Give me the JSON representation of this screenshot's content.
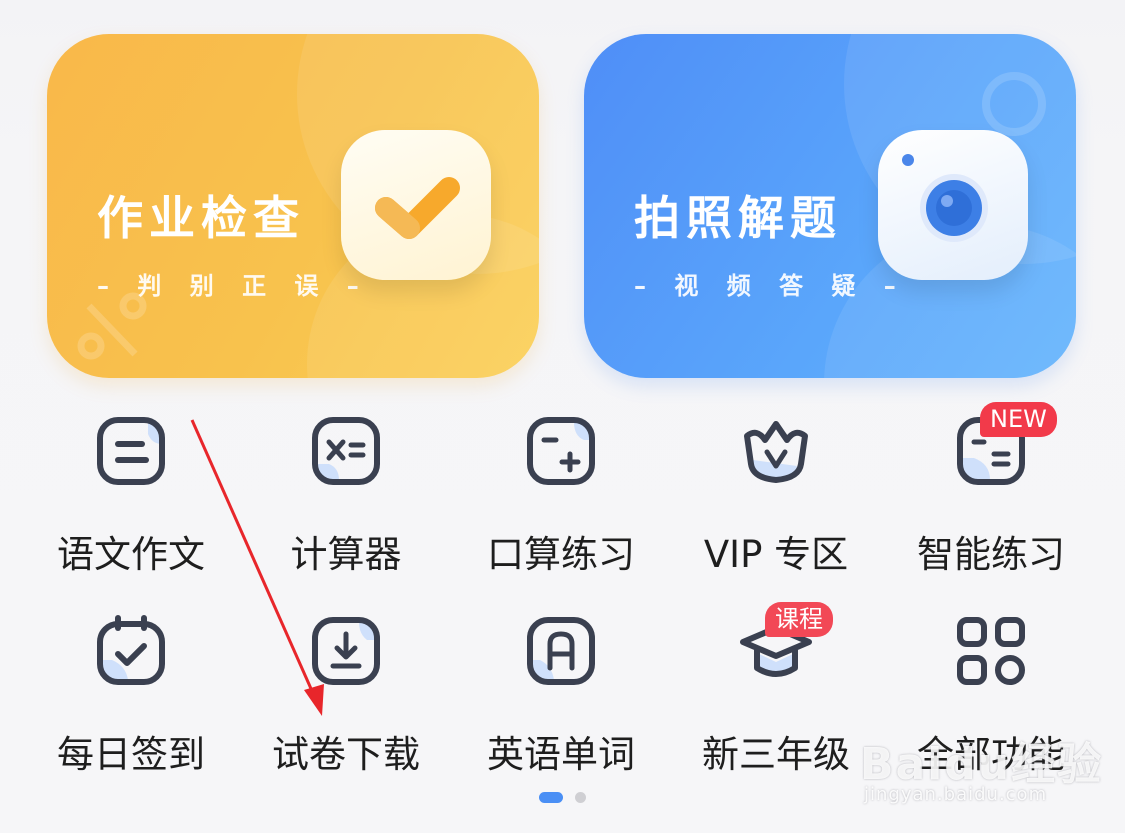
{
  "cards": {
    "homework": {
      "title": "作业检查",
      "subtitle": "– 判 别 正 误 –",
      "icon": "checkmark-icon",
      "color_start": "#f9b84a",
      "color_end": "#fbcf55"
    },
    "photo": {
      "title": "拍照解题",
      "subtitle": "– 视 频 答 疑 –",
      "icon": "camera-icon",
      "color_start": "#4f8ef7",
      "color_end": "#62b3fc"
    }
  },
  "grid": {
    "row1": [
      {
        "label": "语文作文",
        "icon": "chinese-essay-icon"
      },
      {
        "label": "计算器",
        "icon": "calculator-icon"
      },
      {
        "label": "口算练习",
        "icon": "mental-arithmetic-icon"
      },
      {
        "label": "VIP 专区",
        "icon": "vip-crown-icon"
      },
      {
        "label": "智能练习",
        "icon": "smart-practice-icon",
        "badge": "NEW"
      }
    ],
    "row2": [
      {
        "label": "每日签到",
        "icon": "calendar-check-icon"
      },
      {
        "label": "试卷下载",
        "icon": "download-paper-icon"
      },
      {
        "label": "英语单词",
        "icon": "english-word-icon"
      },
      {
        "label": "新三年级",
        "icon": "graduation-cap-icon",
        "badge": "课程"
      },
      {
        "label": "全部功能",
        "icon": "all-features-grid-icon"
      }
    ]
  },
  "pagination": {
    "pages": 2,
    "active_page": 1
  },
  "watermark": {
    "brand": "Baidu经验",
    "url": "jingyan.baidu.com"
  },
  "colors": {
    "icon_stroke": "#3a4050",
    "icon_accent": "#cfe0fb",
    "badge_red": "#f23a4a",
    "annotation_arrow": "#e8262b",
    "page_background": "#f5f5f7"
  }
}
